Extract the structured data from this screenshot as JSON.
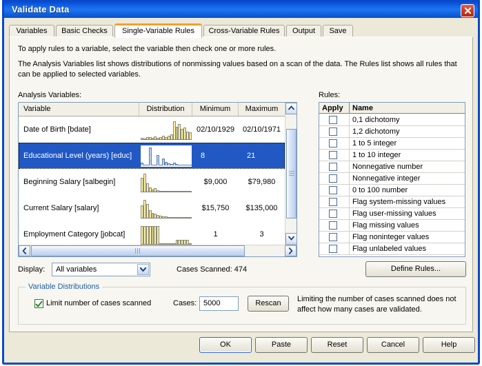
{
  "window": {
    "title": "Validate Data",
    "close_icon": "close-icon",
    "accent_titlebar": "#1466e8",
    "close_button_color": "#d43a22"
  },
  "tabs": [
    {
      "label": "Variables",
      "active": false
    },
    {
      "label": "Basic Checks",
      "active": false
    },
    {
      "label": "Single-Variable Rules",
      "active": true
    },
    {
      "label": "Cross-Variable Rules",
      "active": false
    },
    {
      "label": "Output",
      "active": false
    },
    {
      "label": "Save",
      "active": false
    }
  ],
  "tab_active_accent": "#f0a030",
  "description": {
    "line1": "To apply rules to a variable, select the variable then check one or more rules.",
    "line2": "The Analysis Variables list shows distributions of nonmissing values based on a scan of the data. The Rules list shows all rules that can be applied to selected variables."
  },
  "analysis_variables": {
    "label": "Analysis Variables:",
    "columns": [
      "Variable",
      "Distribution",
      "Minimum",
      "Maximum"
    ],
    "selection_color": "#2158c4",
    "rows": [
      {
        "variable": "Date of Birth [bdate]",
        "minimum": "02/10/1929",
        "maximum": "02/10/1971",
        "selected": false,
        "histogram": [
          8,
          5,
          12,
          10,
          7,
          14,
          6,
          9,
          18,
          12,
          16,
          24,
          92,
          64,
          78,
          52,
          60,
          40,
          34
        ]
      },
      {
        "variable": "Educational Level (years) [educ]",
        "minimum": "8",
        "maximum": "21",
        "selected": true,
        "histogram": [
          14,
          4,
          2,
          82,
          3,
          2,
          48,
          3,
          30,
          16,
          8,
          6,
          12,
          5,
          3,
          2,
          2,
          2,
          2
        ]
      },
      {
        "variable": "Beginning Salary [salbegin]",
        "minimum": "$9,000",
        "maximum": "$79,980",
        "selected": false,
        "histogram": [
          70,
          92,
          44,
          20,
          12,
          16,
          8,
          5,
          4,
          3,
          2,
          2,
          2,
          1,
          1,
          1,
          1,
          1,
          1
        ]
      },
      {
        "variable": "Current Salary [salary]",
        "minimum": "$15,750",
        "maximum": "$135,000",
        "selected": false,
        "histogram": [
          64,
          92,
          72,
          40,
          26,
          20,
          14,
          10,
          8,
          6,
          5,
          4,
          3,
          2,
          2,
          1,
          1,
          1,
          1
        ]
      },
      {
        "variable": "Employment Category [jobcat]",
        "minimum": "1",
        "maximum": "3",
        "selected": false,
        "histogram": [
          98,
          98,
          98,
          98,
          98,
          98,
          98,
          1,
          1,
          1,
          1,
          1,
          1,
          22,
          22,
          22,
          22,
          22,
          1
        ]
      }
    ],
    "scroll_up_icon": "chevron-up-icon",
    "scroll_down_icon": "chevron-down-icon",
    "scroll_left_icon": "chevron-left-icon",
    "scroll_right_icon": "chevron-right-icon"
  },
  "rules": {
    "label": "Rules:",
    "columns": [
      "Apply",
      "Name"
    ],
    "items": [
      {
        "name": "0,1 dichotomy",
        "checked": false
      },
      {
        "name": "1,2 dichotomy",
        "checked": false
      },
      {
        "name": "1 to 5 integer",
        "checked": false
      },
      {
        "name": "1 to 10 integer",
        "checked": false
      },
      {
        "name": "Nonnegative number",
        "checked": false
      },
      {
        "name": "Nonnegative integer",
        "checked": false
      },
      {
        "name": "0 to 100 number",
        "checked": false
      },
      {
        "name": "Flag system-missing values",
        "checked": false
      },
      {
        "name": "Flag user-missing values",
        "checked": false
      },
      {
        "name": "Flag missing values",
        "checked": false
      },
      {
        "name": "Flag noninteger values",
        "checked": false
      },
      {
        "name": "Flag unlabeled values",
        "checked": false
      }
    ]
  },
  "display": {
    "label": "Display:",
    "value": "All variables",
    "arrow_icon": "chevron-down-icon"
  },
  "cases_scanned": "Cases Scanned: 474",
  "define_rules_label": "Define Rules...",
  "variable_distributions": {
    "legend": "Variable Distributions",
    "legend_color": "#1d5fa8",
    "limit_checkbox_label": "Limit number of cases scanned",
    "limit_checked": true,
    "check_icon": "checkmark-icon",
    "cases_label": "Cases:",
    "cases_value": "5000",
    "rescan_label": "Rescan",
    "note": "Limiting the number of cases scanned does not affect how many cases are validated."
  },
  "footer_buttons": [
    {
      "label": "OK",
      "default": true
    },
    {
      "label": "Paste",
      "default": false
    },
    {
      "label": "Reset",
      "default": false
    },
    {
      "label": "Cancel",
      "default": false
    },
    {
      "label": "Help",
      "default": false
    }
  ]
}
